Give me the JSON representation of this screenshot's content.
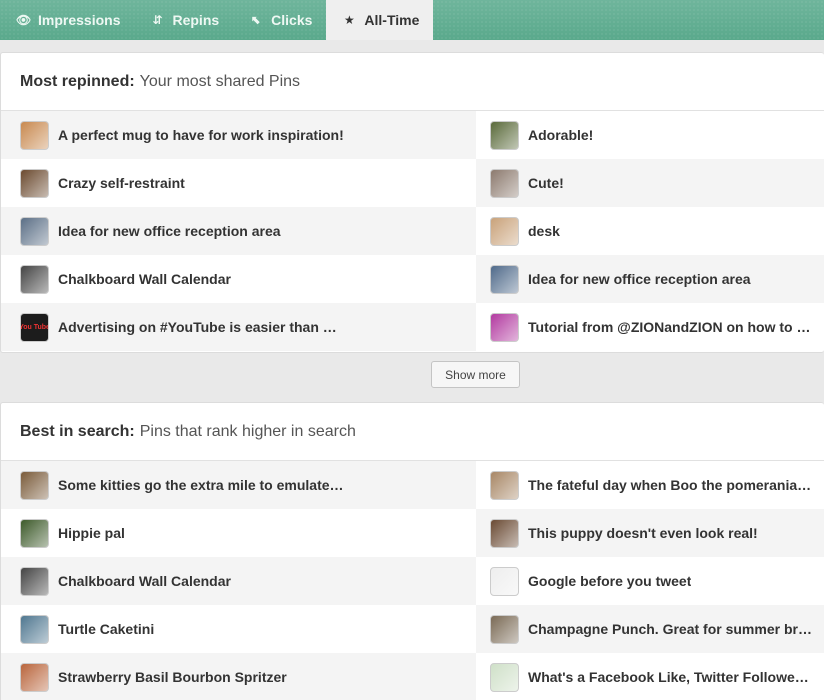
{
  "tabs": [
    {
      "label": "Impressions",
      "icon": "eye-icon",
      "glyph": "👁"
    },
    {
      "label": "Repins",
      "icon": "repin-icon",
      "glyph": "⇵"
    },
    {
      "label": "Clicks",
      "icon": "cursor-icon",
      "glyph": "⬉"
    },
    {
      "label": "All-Time",
      "icon": "star-icon",
      "glyph": "★"
    }
  ],
  "most_repinned": {
    "title": "Most repinned:",
    "subtitle": "Your most shared Pins",
    "rows": [
      {
        "left": "A perfect mug to have for work inspiration!",
        "right": "Adorable!"
      },
      {
        "left": "Crazy self-restraint",
        "right": "Cute!"
      },
      {
        "left": "Idea for new office reception area",
        "right": "desk"
      },
      {
        "left": "Chalkboard Wall Calendar",
        "right": "Idea for new office reception area"
      },
      {
        "left": "Advertising on #YouTube is easier than …",
        "right": "Tutorial from @ZIONandZION on how to …"
      }
    ],
    "thumb_colors": [
      [
        "#c8894f",
        "#5a6a3a"
      ],
      [
        "#6b4a2f",
        "#8c7a6e"
      ],
      [
        "#5b6f86",
        "#c9a27a"
      ],
      [
        "#444444",
        "#4f6a8a"
      ],
      [
        "#222222",
        "#b23aa0"
      ]
    ]
  },
  "show_more": "Show more",
  "best_in_search": {
    "title": "Best in search:",
    "subtitle": "Pins that rank higher in search",
    "rows": [
      {
        "left": "Some kitties go the extra mile to emulate…",
        "right": "The fateful day when Boo the pomerania…"
      },
      {
        "left": "Hippie pal",
        "right": "This puppy doesn't even look real!"
      },
      {
        "left": "Chalkboard Wall Calendar",
        "right": "Google before you tweet"
      },
      {
        "left": "Turtle Caketini",
        "right": "Champagne Punch. Great for summer br…"
      },
      {
        "left": "Strawberry Basil Bourbon Spritzer",
        "right": "What's a Facebook Like, Twitter Followe…"
      }
    ],
    "thumb_colors": [
      [
        "#7a5b3a",
        "#a88766"
      ],
      [
        "#3d5a2a",
        "#6a4a33"
      ],
      [
        "#444444",
        "#eeeeee"
      ],
      [
        "#4f7790",
        "#7a6a55"
      ],
      [
        "#b9653c",
        "#cfe0c8"
      ]
    ]
  },
  "youtube_badge": "You Tube"
}
